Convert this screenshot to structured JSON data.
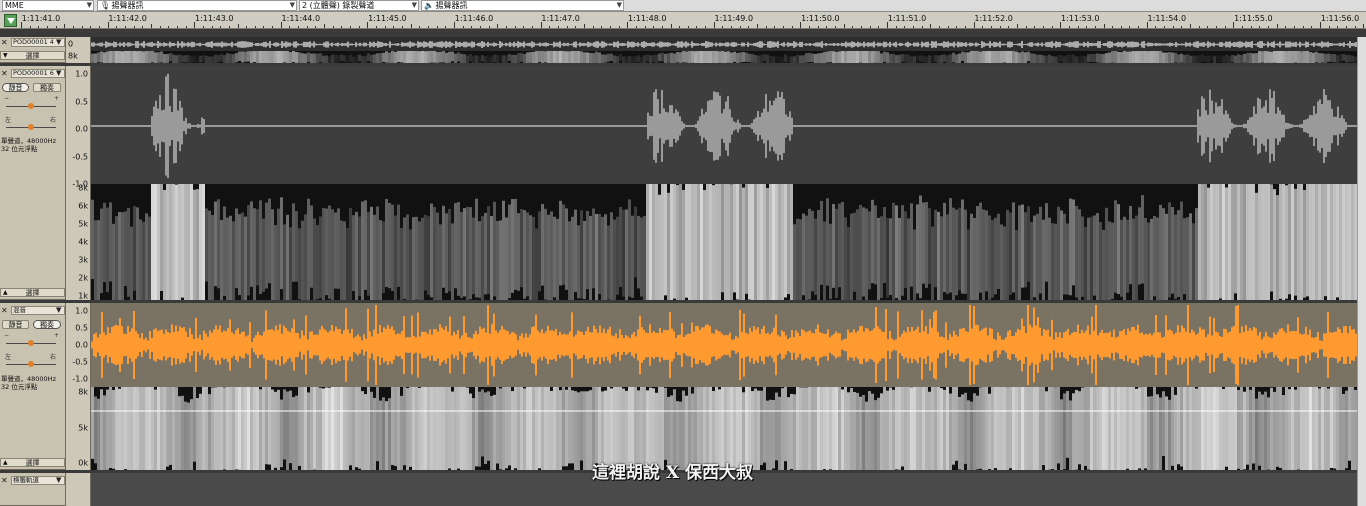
{
  "toolbar": {
    "driver": "MME",
    "input_device": "揚聲器訊",
    "channel_mode": "2 (立體聲) 錄製聲道",
    "output_device": "揚聲器訊"
  },
  "ruler": {
    "labels": [
      "1:11:41.0",
      "1:11:42.0",
      "1:11:43.0",
      "1:11:44.0",
      "1:11:45.0",
      "1:11:46.0",
      "1:11:47.0",
      "1:11:48.0",
      "1:11:49.0",
      "1:11:50.0",
      "1:11:51.0",
      "1:11:52.0",
      "1:11:53.0",
      "1:11:54.0",
      "1:11:55.0",
      "1:11:56.0"
    ]
  },
  "tracks": [
    {
      "name": "POD00001 4",
      "bottom_button": "選擇",
      "scale": {
        "waveform": [
          "0"
        ],
        "spectrum": [
          "8k"
        ]
      }
    },
    {
      "name": "POD00001 6",
      "mute": "靜音",
      "solo": "獨奏",
      "pan_left": "左",
      "pan_right": "右",
      "info_line1": "單聲道，48000Hz",
      "info_line2": "32 位元浮點",
      "bottom_button": "選擇",
      "scale": {
        "waveform": [
          "1.0",
          "0.5",
          "0.0",
          "-0.5",
          "-1.0"
        ],
        "spectrum": [
          "8k",
          "6k",
          "5k",
          "4k",
          "3k",
          "2k",
          "1k"
        ]
      }
    },
    {
      "name": "混音",
      "mute": "靜音",
      "solo": "獨奏",
      "pan_left": "左",
      "pan_right": "右",
      "info_line1": "單聲道，48000Hz",
      "info_line2": "32 位元浮點",
      "bottom_button": "選擇",
      "scale": {
        "waveform": [
          "1.0",
          "0.5",
          "0.0",
          "-0.5",
          "-1.0"
        ],
        "spectrum": [
          "8k",
          "5k",
          "0k"
        ]
      }
    },
    {
      "name": "標籤軌道"
    }
  ],
  "watermark": "這裡胡說 X 保西大叔",
  "colors": {
    "ruler_bg": "#cfccc2",
    "header_bg": "#c8c2b0",
    "track2_wave_bg": "#3e3e3e",
    "track2_wave": "#9a9a9a",
    "mix_wave_bg": "#7a7262",
    "mix_wave": "#ff9a30",
    "knob": "#e0802a",
    "play_green": "#58a058"
  }
}
